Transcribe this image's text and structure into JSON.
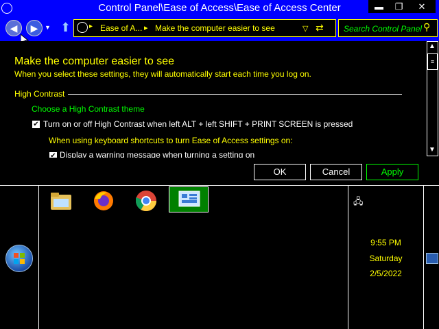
{
  "window": {
    "title": "Control Panel\\Ease of Access\\Ease of Access Center",
    "minimize_glyph": "▬",
    "restore_glyph": "❐",
    "close_glyph": "✕"
  },
  "nav": {
    "address_crumb_1": "Ease of A...",
    "address_sep": "▸",
    "address_crumb_2": "Make the computer easier to see",
    "search_placeholder": "Search Control Panel"
  },
  "content": {
    "heading": "Make the computer easier to see",
    "subheading": "When you select these settings, they will automatically start each time you log on.",
    "section_title": "High Contrast",
    "link_choose_theme": "Choose a High Contrast theme",
    "checkbox_hc_label": "Turn on or off High Contrast when left ALT + left SHIFT + PRINT SCREEN is pressed",
    "shortcut_note": "When using keyboard shortcuts to turn Ease of Access settings on:",
    "checkbox_warning_label": "Display a warning message when turning a setting on"
  },
  "buttons": {
    "ok": "OK",
    "cancel": "Cancel",
    "apply": "Apply"
  },
  "clock": {
    "time": "9:55 PM",
    "day": "Saturday",
    "date": "2/5/2022"
  },
  "taskbar_icons": [
    "folder-icon",
    "firefox-icon",
    "chrome-icon",
    "control-panel-icon"
  ],
  "colors": {
    "titlebar": "#0000ff",
    "highlight_text": "#ffff00",
    "link_text": "#00ff00",
    "active_taskbar": "#008000"
  }
}
